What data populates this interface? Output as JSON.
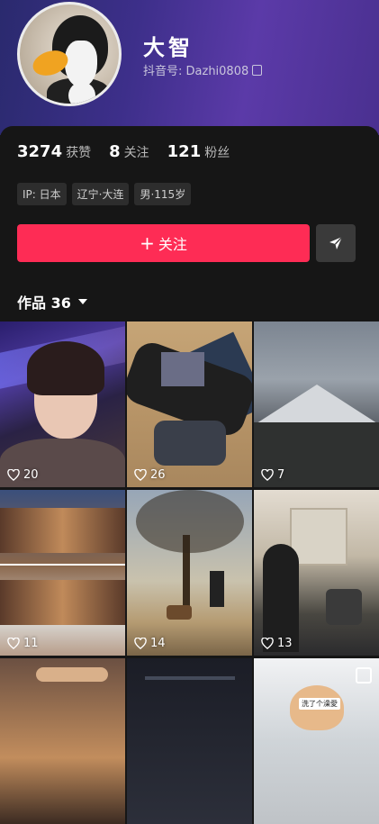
{
  "profile": {
    "name": "大智",
    "handle": "抖音号: Dazhi0808"
  },
  "stats": [
    {
      "num": "3274",
      "label": "获赞"
    },
    {
      "num": "8",
      "label": "关注"
    },
    {
      "num": "121",
      "label": "粉丝"
    }
  ],
  "tags": [
    "IP: 日本",
    "辽宁·大连",
    "男·115岁"
  ],
  "actions": {
    "follow_label": "关注",
    "follow_plus": "+",
    "share_icon": "send-icon"
  },
  "works": {
    "label": "作品 36"
  },
  "grid": [
    {
      "likes": "20"
    },
    {
      "likes": "26"
    },
    {
      "likes": "7"
    },
    {
      "likes": "11"
    },
    {
      "likes": "14"
    },
    {
      "likes": "13"
    },
    {
      "likes": ""
    },
    {
      "likes": ""
    },
    {
      "likes": "",
      "caption": "洗了个澡愛"
    }
  ],
  "colors": {
    "accent": "#fe2c55",
    "panel": "#161616",
    "tag_bg": "#2d2d2d"
  }
}
